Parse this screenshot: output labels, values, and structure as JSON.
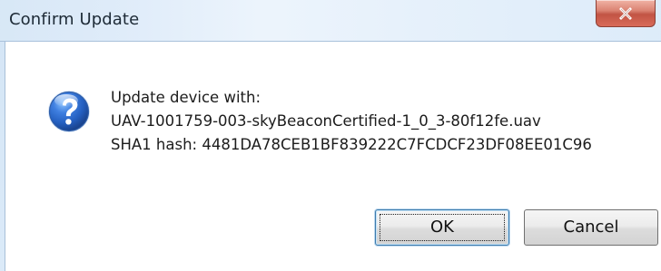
{
  "window": {
    "title": "Confirm Update",
    "close_label": "X"
  },
  "message": {
    "line1": "Update device with:",
    "line2": "UAV-1001759-003-skyBeaconCertified-1_0_3-80f12fe.uav",
    "line3": "SHA1 hash: 4481DA78CEB1BF839222C7FCDCF23DF08EE01C96"
  },
  "buttons": {
    "ok": "OK",
    "cancel": "Cancel"
  },
  "icons": {
    "question": "question-icon",
    "close": "close-icon"
  },
  "colors": {
    "title_bar": "#dce9f7",
    "close_button": "#d86b59",
    "question_icon": "#2a67c7",
    "default_button_border": "#3d7bad"
  }
}
